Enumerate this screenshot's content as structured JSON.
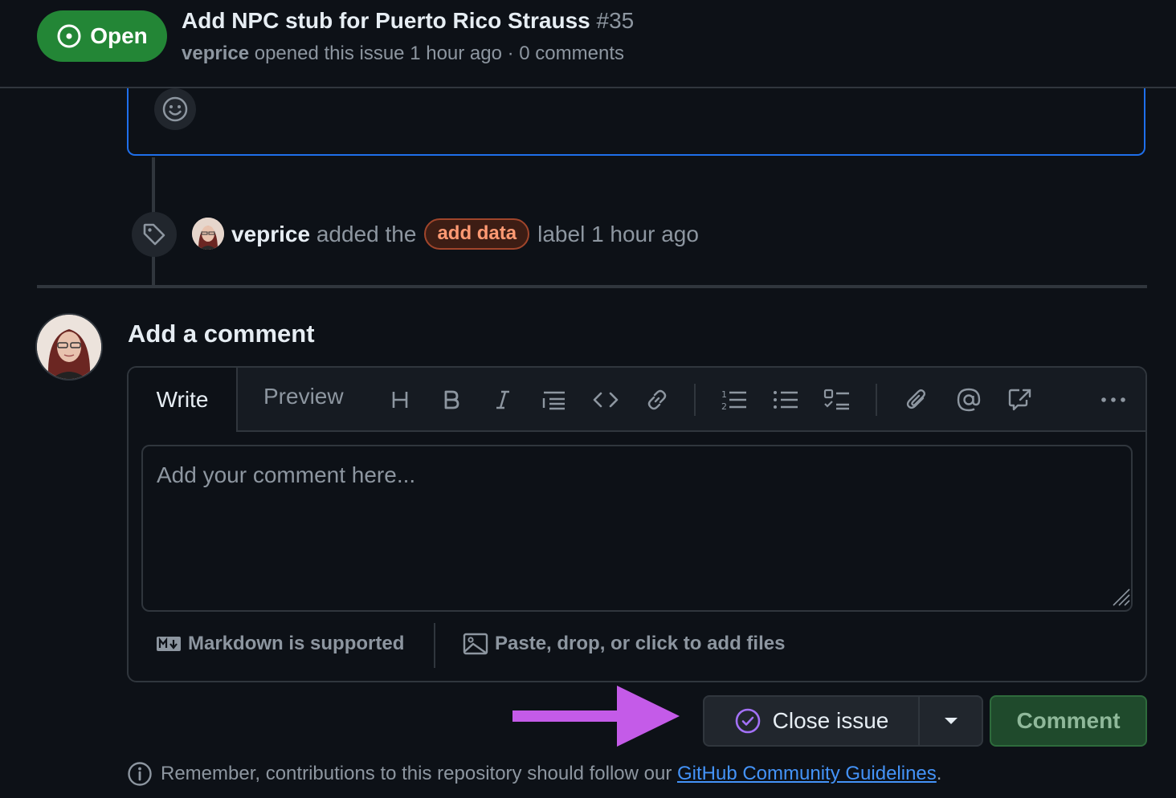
{
  "issue": {
    "state": "Open",
    "title": "Add NPC stub for Puerto Rico Strauss",
    "number": "#35",
    "author": "veprice",
    "opened_text": "opened this issue 1 hour ago · 0 comments"
  },
  "label_event": {
    "actor": "veprice",
    "action": "added the",
    "label": "add data",
    "suffix": "label 1 hour ago"
  },
  "comment_form": {
    "heading": "Add a comment",
    "tab_write": "Write",
    "tab_preview": "Preview",
    "placeholder": "Add your comment here...",
    "markdown_note": "Markdown is supported",
    "files_note": "Paste, drop, or click to add files",
    "close_label": "Close issue",
    "comment_label": "Comment"
  },
  "footer": {
    "text": "Remember, contributions to this repository should follow our",
    "link": "GitHub Community Guidelines",
    "end": "."
  },
  "colors": {
    "open_green": "#238636",
    "label_border": "#a0452b",
    "label_text": "#ff9a73",
    "arrow": "#c45be8",
    "link": "#4493f8"
  },
  "icons": [
    "issue-opened-icon",
    "smiley-icon",
    "tag-icon",
    "heading-icon",
    "bold-icon",
    "italic-icon",
    "quote-icon",
    "code-icon",
    "link-icon",
    "ordered-list-icon",
    "unordered-list-icon",
    "task-list-icon",
    "paperclip-icon",
    "mention-icon",
    "cross-reference-icon",
    "kebab-icon",
    "markdown-icon",
    "image-icon",
    "check-circle-icon",
    "triangle-down-icon",
    "info-icon"
  ]
}
